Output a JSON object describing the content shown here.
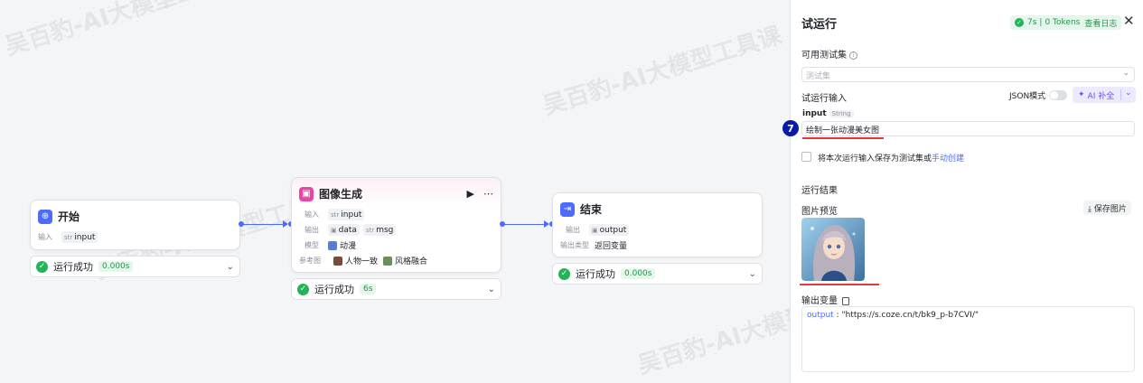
{
  "watermark": "吴百豹-AI大模型工具课",
  "nodes": {
    "start": {
      "title": "开始",
      "input_label": "输入",
      "input_type": "str",
      "input_name": "input",
      "status": "运行成功",
      "duration": "0.000s"
    },
    "image_gen": {
      "title": "图像生成",
      "run_icon": "▶",
      "more_icon": "⋯",
      "input_label": "输入",
      "input_type": "str",
      "input_name": "input",
      "output_label": "输出",
      "output_data": "data",
      "output_type": "str",
      "output_msg": "msg",
      "model_label": "模型",
      "model_value": "动漫",
      "ref_label": "参考图",
      "ref_1": "人物一致",
      "ref_2": "风格融合",
      "status": "运行成功",
      "duration": "6s"
    },
    "end": {
      "title": "结束",
      "output_label": "输出",
      "output_name": "output",
      "output_type_label": "输出类型",
      "output_type_value": "返回变量",
      "status": "运行成功",
      "duration": "0.000s"
    }
  },
  "panel": {
    "title": "试运行",
    "run_time": "7s",
    "tokens": "0 Tokens",
    "log_link": "查看日志",
    "close": "✕",
    "testset_label": "可用测试集",
    "testset_placeholder": "测试集",
    "run_input_label": "试运行输入",
    "json_mode_label": "JSON模式",
    "ai_fill_label": "AI 补全",
    "input_name": "input",
    "input_type": "String",
    "input_value": "绘制一张动漫美女图",
    "step_number": "7",
    "save_note": "将本次运行输入保存为测试集或",
    "manual_create": "手动创建",
    "result_label": "运行结果",
    "image_preview_label": "图片预览",
    "save_image_label": "保存图片",
    "output_var_label": "输出变量",
    "output_key": "output",
    "output_value": "\"https://s.coze.cn/t/bk9_p-b7CVI/\""
  },
  "colors": {
    "accent": "#4d6bfe",
    "success": "#23b35a",
    "ai": "#6d4dff",
    "annotation_red": "#e53935",
    "step_badge": "#0a1aa8"
  }
}
